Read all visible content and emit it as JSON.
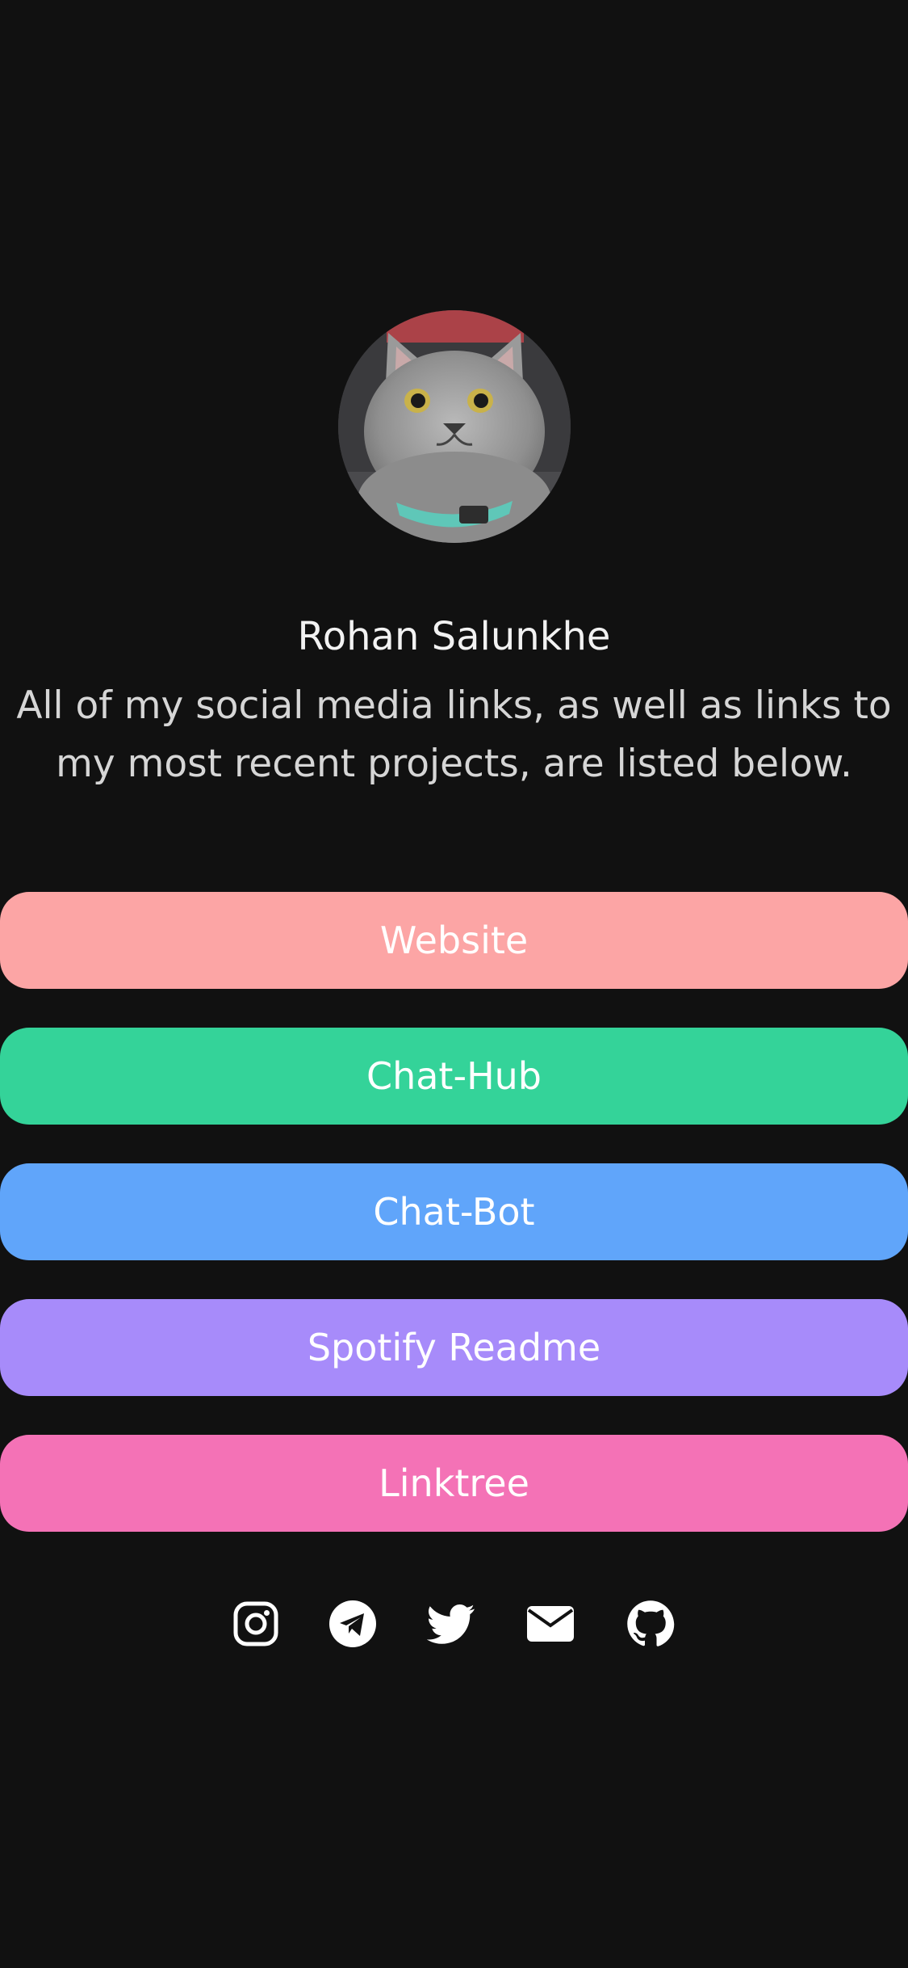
{
  "profile": {
    "name": "Rohan Salunkhe",
    "bio": "All of my social media links, as well as links to my most recent projects, are listed below."
  },
  "links": [
    {
      "label": "Website",
      "color": "#fca5a5"
    },
    {
      "label": "Chat-Hub",
      "color": "#34d399"
    },
    {
      "label": "Chat-Bot",
      "color": "#60a5fa"
    },
    {
      "label": "Spotify Readme",
      "color": "#a78bfa"
    },
    {
      "label": "Linktree",
      "color": "#f472b6"
    }
  ],
  "socials": [
    {
      "icon": "instagram-icon"
    },
    {
      "icon": "telegram-icon"
    },
    {
      "icon": "twitter-icon"
    },
    {
      "icon": "email-icon"
    },
    {
      "icon": "github-icon"
    }
  ],
  "colors": {
    "background": "#111111",
    "text": "#ffffff",
    "subtext": "#d6d6d6"
  }
}
